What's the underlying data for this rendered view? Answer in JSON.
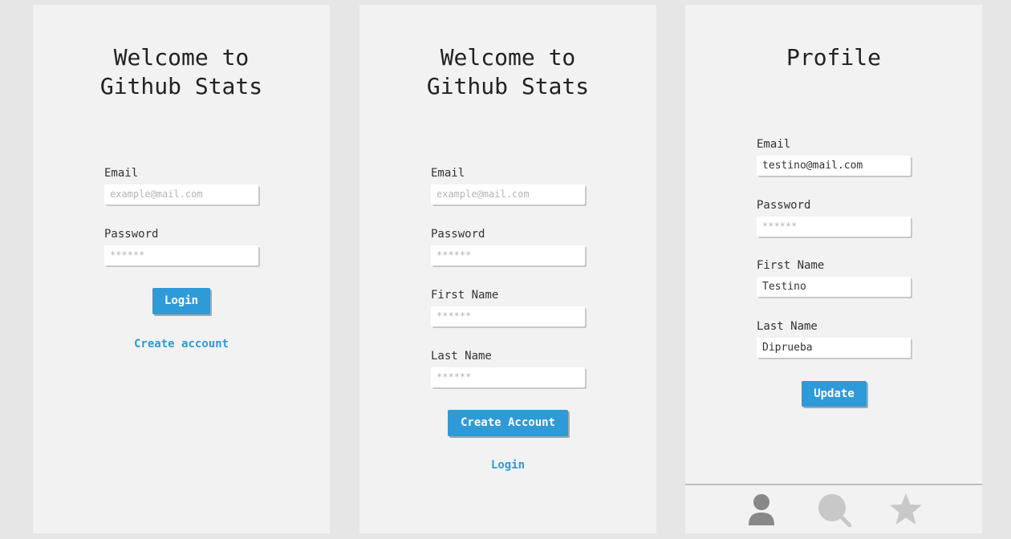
{
  "login_screen": {
    "title_line1": "Welcome to",
    "title_line2": "Github Stats",
    "email_label": "Email",
    "email_placeholder": "example@mail.com",
    "password_label": "Password",
    "password_placeholder": "******",
    "login_button": "Login",
    "create_account_link": "Create account"
  },
  "signup_screen": {
    "title_line1": "Welcome to",
    "title_line2": "Github Stats",
    "email_label": "Email",
    "email_placeholder": "example@mail.com",
    "password_label": "Password",
    "password_placeholder": "******",
    "first_name_label": "First Name",
    "first_name_placeholder": "******",
    "last_name_label": "Last Name",
    "last_name_placeholder": "******",
    "create_account_button": "Create Account",
    "login_link": "Login"
  },
  "profile_screen": {
    "title": "Profile",
    "email_label": "Email",
    "email_value": "testino@mail.com",
    "password_label": "Password",
    "password_placeholder": "******",
    "first_name_label": "First Name",
    "first_name_value": "Testino",
    "last_name_label": "Last Name",
    "last_name_value": "Diprueba",
    "update_button": "Update",
    "bottom_nav": [
      {
        "icon": "user-icon"
      },
      {
        "icon": "search-icon"
      },
      {
        "icon": "star-icon"
      }
    ]
  },
  "colors": {
    "accent": "#2f9ad8",
    "screen_bg": "#f2f2f2",
    "page_bg": "#e6e6e6"
  }
}
